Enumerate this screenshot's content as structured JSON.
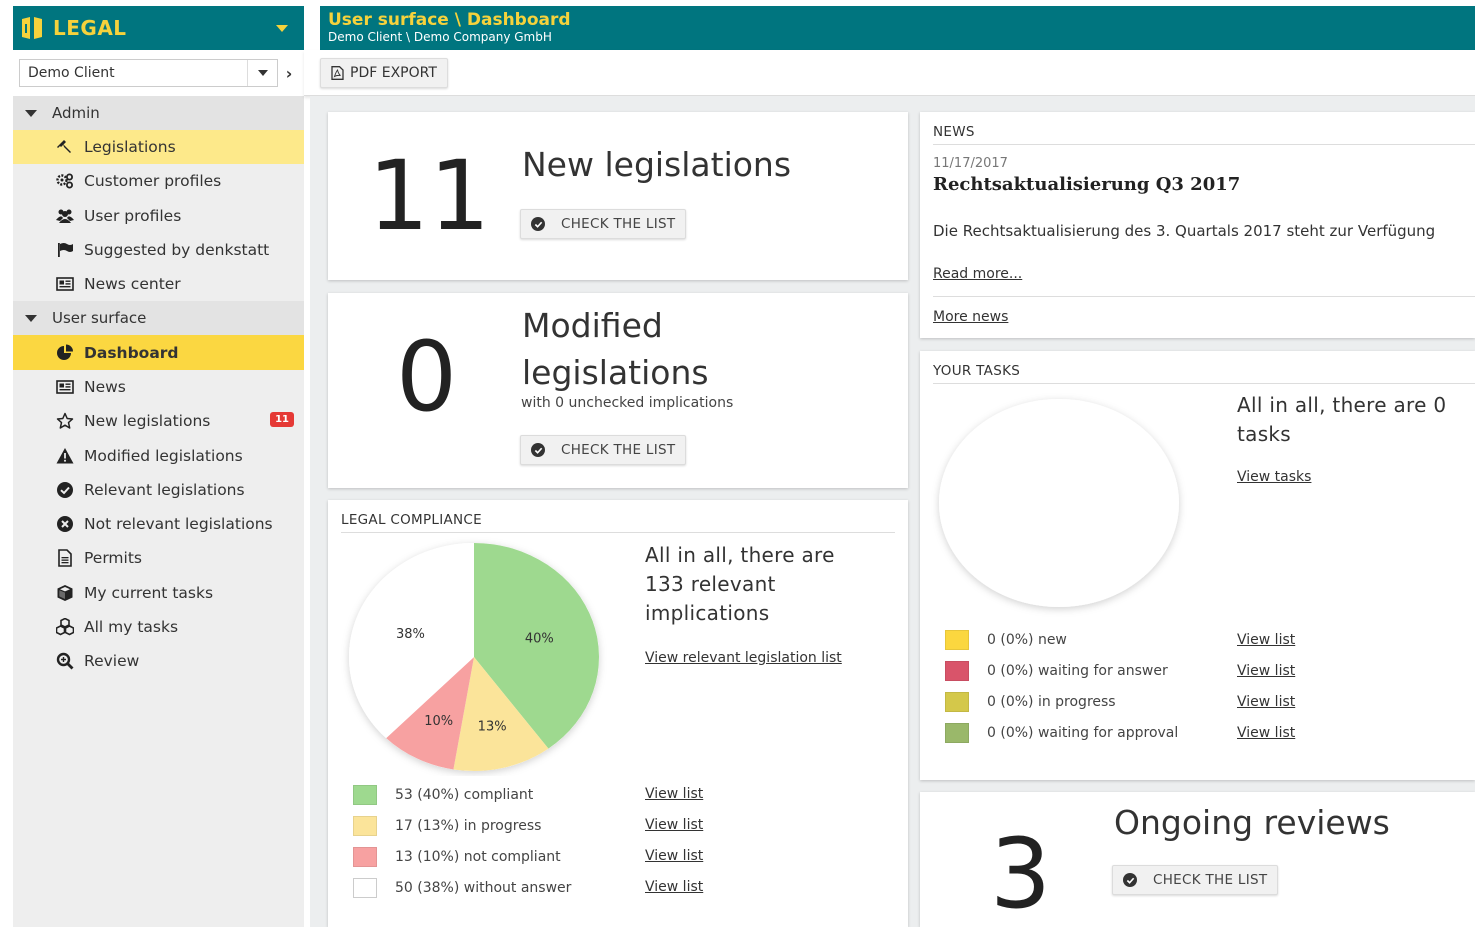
{
  "brand": {
    "name": "LEGAL"
  },
  "client_selector": {
    "value": "Demo Client"
  },
  "sidebar": {
    "sections": [
      {
        "label": "Admin",
        "items": [
          {
            "label": "Legislations",
            "icon": "gavel-icon"
          },
          {
            "label": "Customer profiles",
            "icon": "cogs-icon"
          },
          {
            "label": "User profiles",
            "icon": "users-icon"
          },
          {
            "label": "Suggested by denkstatt",
            "icon": "flag-icon"
          },
          {
            "label": "News center",
            "icon": "newspaper-icon"
          }
        ]
      },
      {
        "label": "User surface",
        "items": [
          {
            "label": "Dashboard",
            "icon": "pie-chart-icon"
          },
          {
            "label": "News",
            "icon": "newspaper-icon"
          },
          {
            "label": "New legislations",
            "icon": "star-icon",
            "badge": "11"
          },
          {
            "label": "Modified legislations",
            "icon": "warning-icon"
          },
          {
            "label": "Relevant legislations",
            "icon": "check-circle-icon"
          },
          {
            "label": "Not relevant legislations",
            "icon": "times-circle-icon"
          },
          {
            "label": "Permits",
            "icon": "document-icon"
          },
          {
            "label": "My current tasks",
            "icon": "cube-icon"
          },
          {
            "label": "All my tasks",
            "icon": "cubes-icon"
          },
          {
            "label": "Review",
            "icon": "search-icon"
          }
        ]
      }
    ]
  },
  "header": {
    "title": "User surface \\ Dashboard",
    "subtitle": "Demo Client \\ Demo Company GmbH"
  },
  "toolbar": {
    "pdf_export_label": "PDF EXPORT"
  },
  "new_legislations": {
    "count": "11",
    "title": "New legislations",
    "button": "CHECK THE LIST"
  },
  "modified_legislations": {
    "count": "0",
    "title_line1": "Modified",
    "title_line2": "legislations",
    "subtitle": "with 0 unchecked implications",
    "button": "CHECK THE LIST"
  },
  "legal_compliance": {
    "heading": "LEGAL COMPLIANCE",
    "summary_line1": "All in all, there are",
    "summary_line2": "133 relevant",
    "summary_line3": "implications",
    "view_link": "View relevant legislation list",
    "legend": [
      {
        "label": "53 (40%) compliant",
        "color": "#9ed98f",
        "link": "View list"
      },
      {
        "label": "17 (13%) in progress",
        "color": "#fbe49a",
        "link": "View list"
      },
      {
        "label": "13 (10%) not compliant",
        "color": "#f7a1a1",
        "link": "View list"
      },
      {
        "label": "50 (38%) without answer",
        "color": "#ffffff",
        "link": "View list"
      }
    ]
  },
  "chart_data": {
    "type": "pie",
    "categories": [
      "compliant",
      "in progress",
      "not compliant",
      "without answer"
    ],
    "values": [
      53,
      17,
      13,
      50
    ],
    "labels": [
      "40%",
      "13%",
      "10%",
      "38%"
    ],
    "colors": [
      "#9ed98f",
      "#fbe49a",
      "#f7a1a1",
      "#ffffff"
    ]
  },
  "news": {
    "heading": "NEWS",
    "date": "11/17/2017",
    "title": "Rechtsaktualisierung Q3 2017",
    "body": "Die Rechtsaktualisierung des 3. Quartals 2017 steht zur Verfügung",
    "read_more": "Read more...",
    "more_news": "More news"
  },
  "tasks": {
    "heading": "YOUR TASKS",
    "summary_line1": "All in all, there are 0",
    "summary_line2": "tasks",
    "view_link": "View tasks",
    "legend": [
      {
        "label": "0 (0%) new",
        "color": "#fbd73f",
        "link": "View list"
      },
      {
        "label": "0 (0%) waiting for answer",
        "color": "#d9546a",
        "link": "View list"
      },
      {
        "label": "0 (0%) in progress",
        "color": "#d4c84a",
        "link": "View list"
      },
      {
        "label": "0 (0%) waiting for approval",
        "color": "#9ab86a",
        "link": "View list"
      }
    ]
  },
  "ongoing_reviews": {
    "count": "3",
    "title": "Ongoing reviews",
    "button": "CHECK THE LIST"
  }
}
